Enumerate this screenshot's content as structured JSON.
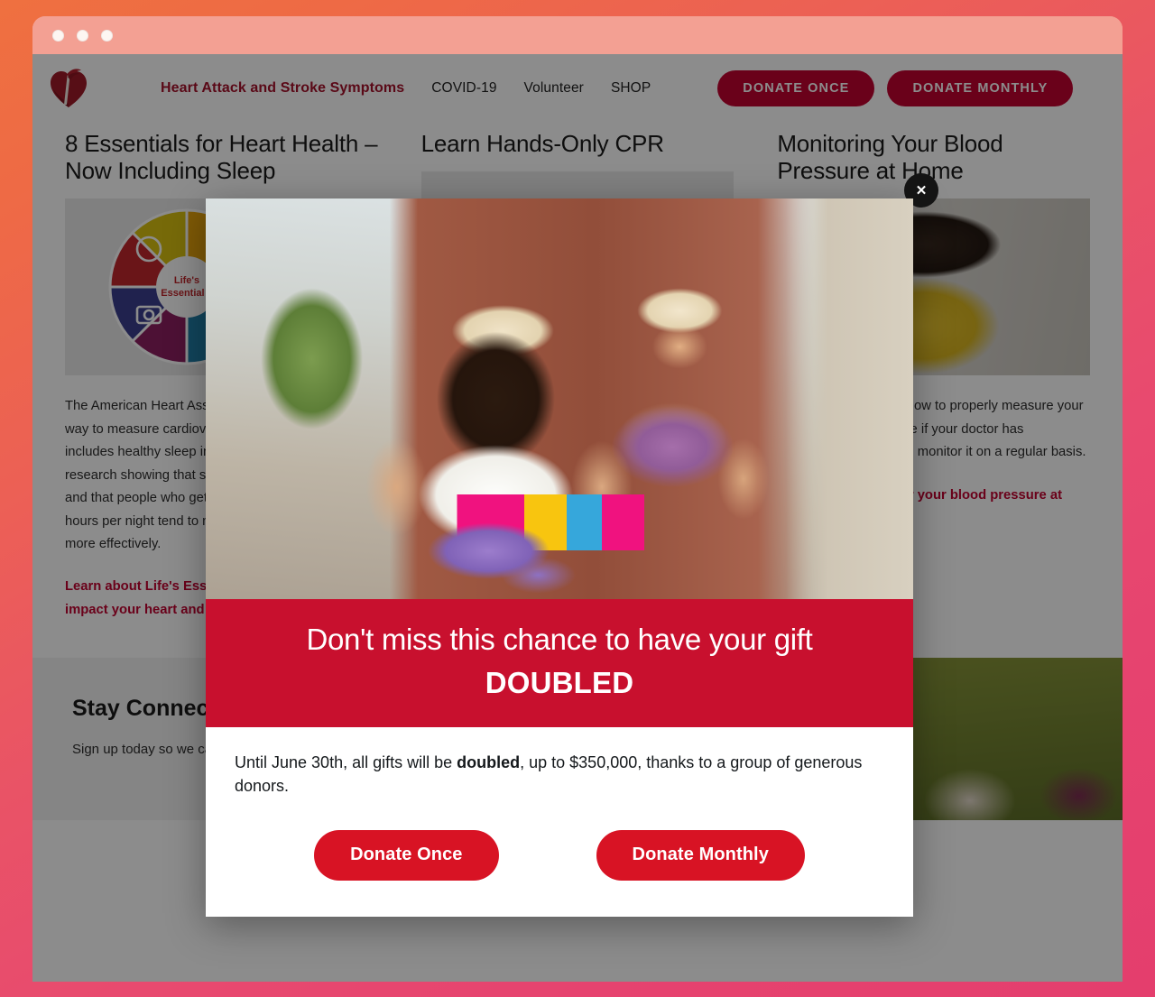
{
  "window": {
    "traffic_lights": [
      "close",
      "minimize",
      "maximize"
    ]
  },
  "site_header": {
    "logo_name": "american-heart-association-logo",
    "nav": [
      {
        "label": "Heart Attack and Stroke Symptoms",
        "primary": true
      },
      {
        "label": "COVID-19",
        "primary": false
      },
      {
        "label": "Volunteer",
        "primary": false
      },
      {
        "label": "SHOP",
        "primary": false
      }
    ],
    "donate_once_label": "DONATE ONCE",
    "donate_monthly_label": "DONATE MONTHLY",
    "button_color": "#c10230",
    "primary_link_color": "#a4112b"
  },
  "articles": [
    {
      "title": "8 Essentials for Heart Health – Now Including Sleep",
      "media": "lifes-essential-8-wheel-graphic",
      "body": "The American Heart Association announced a new way to measure cardiovascular health that now includes healthy sleep in response to the latest research showing that sleep impacts overall health, and that people who get the recommended 7-9 hours per night tend to manage other health factors more effectively.",
      "link_bold": "Learn about Life's Essential 8",
      "link_rest": "and how they impact your heart and brain health"
    },
    {
      "title": "Learn Hands-Only CPR",
      "media": "hands-only-cpr-photo",
      "body": "",
      "link_bold": "",
      "link_rest": ""
    },
    {
      "title": "Monitoring Your Blood Pressure at Home",
      "media": "woman-in-yellow-top-photo",
      "body": "It's important to know how to properly measure your blood pressure at home if your doctor has recommended that you monitor it on a regular basis.",
      "link_bold": "Learn how to monitor your blood pressure at home",
      "link_rest": "",
      "chevron": "›"
    }
  ],
  "connected": {
    "title": "Stay Connected",
    "subtitle": "Sign up today so we can stay healthy together! You'll receive:",
    "media": "seniors-outdoors-photo"
  },
  "modal": {
    "close_label": "✕",
    "hero_image_name": "smiling-couple-on-bicycles-photo",
    "banner_line1": "Don't miss this chance to have your gift",
    "banner_line2": "DOUBLED",
    "banner_color": "#c8102e",
    "copy_before": "Until June 30th, all gifts will be ",
    "copy_bold": "doubled",
    "copy_after": ", up to $350,000, thanks to a group of generous donors.",
    "donate_once_label": "Donate Once",
    "donate_monthly_label": "Donate Monthly",
    "cta_color": "#d81324"
  }
}
